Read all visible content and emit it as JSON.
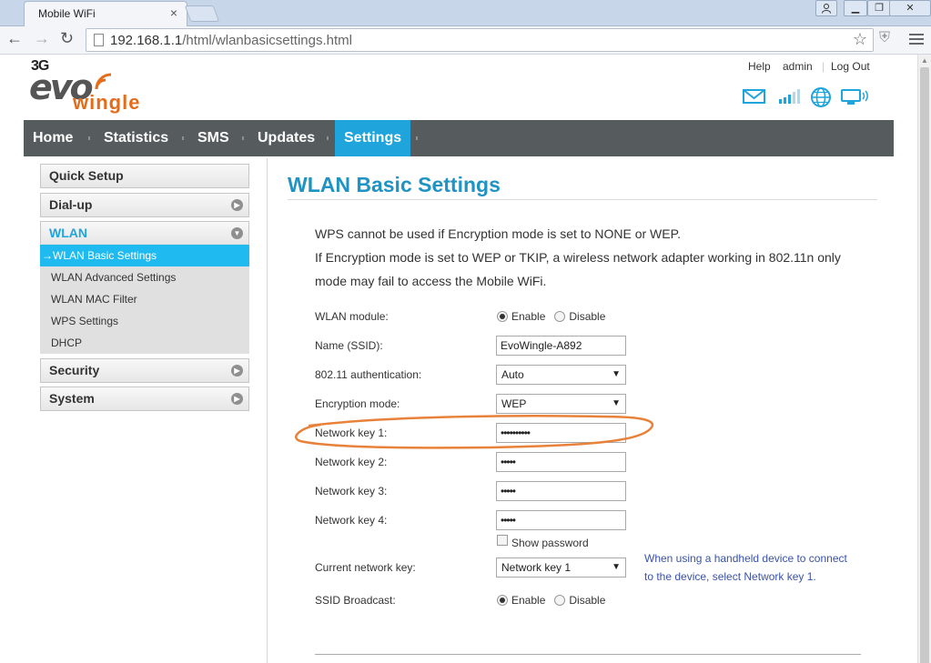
{
  "browser": {
    "tab_title": "Mobile WiFi",
    "tab_close": "×",
    "url_host": "192.168.1.1",
    "url_path": "/html/wlanbasicsettings.html",
    "window_min": "▁",
    "window_max": "❐",
    "window_close": "✕",
    "user_glyph": "👤"
  },
  "logo": {
    "prefix": "3G",
    "brand": "evo",
    "wordmark": "wingle"
  },
  "header": {
    "help": "Help",
    "user": "admin",
    "logout": "Log Out"
  },
  "nav": {
    "items": [
      "Home",
      "Statistics",
      "SMS",
      "Updates",
      "Settings"
    ],
    "active": "Settings"
  },
  "sidebar": {
    "quick_setup": "Quick Setup",
    "dialup": "Dial-up",
    "wlan": "WLAN",
    "wlan_items": [
      "→WLAN Basic Settings",
      "WLAN Advanced Settings",
      "WLAN MAC Filter",
      "WPS Settings",
      "DHCP"
    ],
    "security": "Security",
    "system": "System"
  },
  "content": {
    "title": "WLAN Basic Settings",
    "note1": "WPS cannot be used if Encryption mode is set to NONE or WEP.",
    "note2": "If Encryption mode is set to WEP or TKIP, a wireless network adapter working in 802.11n only",
    "note3": "mode may fail to access the Mobile WiFi.",
    "fields": {
      "wlan_module_label": "WLAN module:",
      "enable": "Enable",
      "disable": "Disable",
      "ssid_label": "Name (SSID):",
      "ssid_value": "EvoWingle-A892",
      "auth_label": "802.11 authentication:",
      "auth_value": "Auto",
      "enc_label": "Encryption mode:",
      "enc_value": "WEP",
      "key1_label": "Network key 1:",
      "key1_value": "••••••••••",
      "key2_label": "Network key 2:",
      "key2_value": "•••••",
      "key3_label": "Network key 3:",
      "key3_value": "•••••",
      "key4_label": "Network key 4:",
      "key4_value": "•••••",
      "show_password": "Show password",
      "current_key_label": "Current network key:",
      "current_key_value": "Network key 1",
      "hint_line1": "When using a handheld device to connect",
      "hint_line2": "to the device, select Network key 1.",
      "ssid_broadcast_label": "SSID Broadcast:"
    }
  },
  "colors": {
    "accent": "#1fa4dc",
    "nav_bg": "#565c5e",
    "annotation": "#e8823a",
    "hint_text": "#3a52a8"
  }
}
